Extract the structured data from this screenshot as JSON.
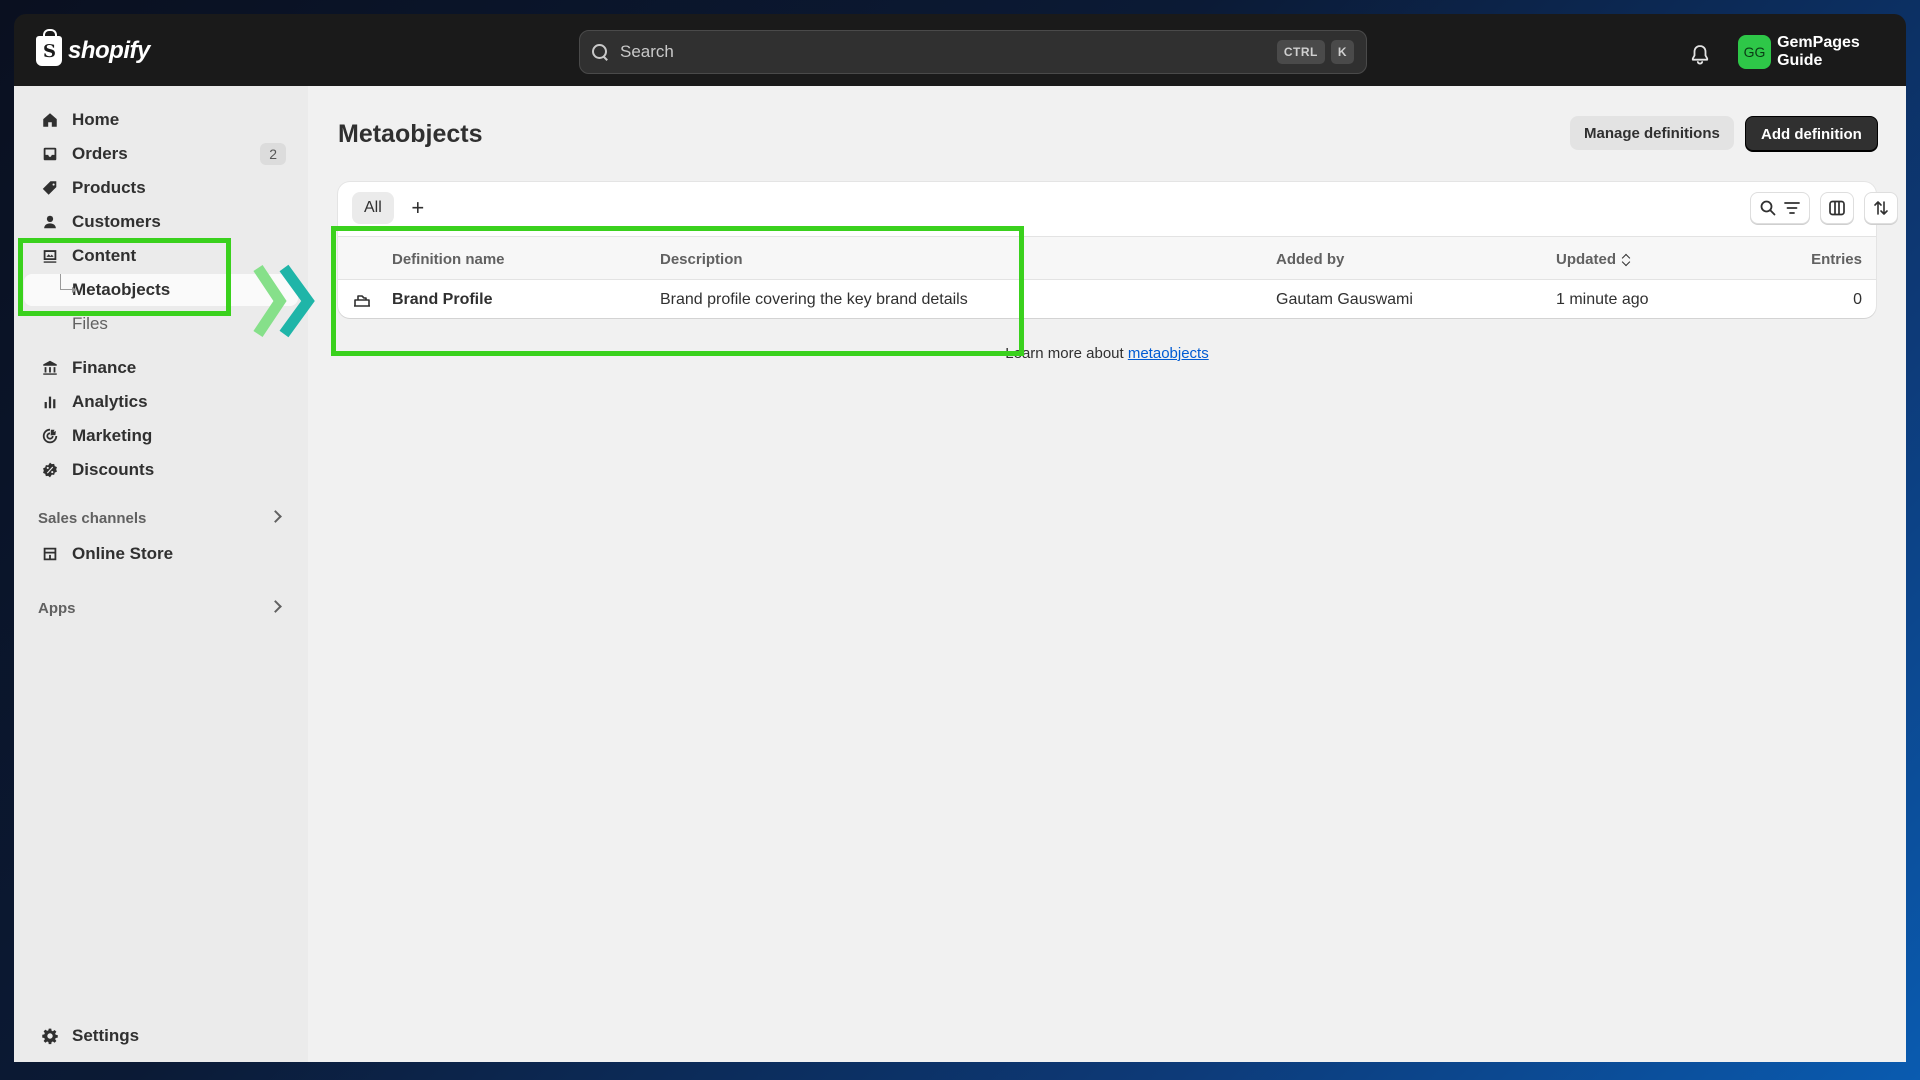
{
  "topbar": {
    "brand": "shopify",
    "search_placeholder": "Search",
    "shortcut_keys": [
      "CTRL",
      "K"
    ],
    "account_initials": "GG",
    "account_name": "GemPages Guide"
  },
  "sidebar": {
    "items": [
      {
        "label": "Home",
        "icon": "home-icon"
      },
      {
        "label": "Orders",
        "icon": "orders-icon",
        "badge": "2"
      },
      {
        "label": "Products",
        "icon": "tag-icon"
      },
      {
        "label": "Customers",
        "icon": "person-icon"
      },
      {
        "label": "Content",
        "icon": "content-icon"
      }
    ],
    "content_sub": [
      {
        "label": "Metaobjects",
        "active": true
      },
      {
        "label": "Files",
        "active": false
      }
    ],
    "items2": [
      {
        "label": "Finance",
        "icon": "bank-icon"
      },
      {
        "label": "Analytics",
        "icon": "bar-chart-icon"
      },
      {
        "label": "Marketing",
        "icon": "target-icon"
      },
      {
        "label": "Discounts",
        "icon": "discount-icon"
      }
    ],
    "sales_channels_label": "Sales channels",
    "online_store_label": "Online Store",
    "apps_label": "Apps",
    "settings_label": "Settings"
  },
  "main": {
    "title": "Metaobjects",
    "manage_button": "Manage definitions",
    "add_button": "Add definition",
    "tab_all": "All",
    "tab_add": "+",
    "columns": [
      "Definition name",
      "Description",
      "Added by",
      "Updated",
      "Entries"
    ],
    "rows": [
      {
        "name": "Brand Profile",
        "description": "Brand profile covering the key brand details",
        "added_by": "Gautam Gauswami",
        "updated": "1 minute ago",
        "entries": "0"
      }
    ],
    "learn_more_prefix": "Learn more about ",
    "learn_more_link": "metaobjects"
  },
  "colors": {
    "highlight": "#3ad11d",
    "primary_button": "#303030",
    "link": "#005bd3",
    "avatar": "#2ec748"
  }
}
